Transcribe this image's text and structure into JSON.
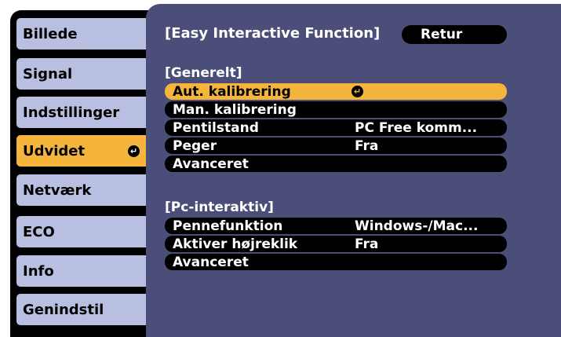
{
  "sidebar": {
    "items": [
      {
        "label": "Billede"
      },
      {
        "label": "Signal"
      },
      {
        "label": "Indstillinger"
      },
      {
        "label": "Udvidet"
      },
      {
        "label": "Netværk"
      },
      {
        "label": "ECO"
      },
      {
        "label": "Info"
      },
      {
        "label": "Genindstil"
      }
    ],
    "active_index": 3
  },
  "header": {
    "title": "[Easy Interactive Function]",
    "return_label": "Retur"
  },
  "sections": [
    {
      "title": "[Generelt]",
      "rows": [
        {
          "label": "Aut. kalibrering",
          "value": "",
          "selected": true
        },
        {
          "label": "Man. kalibrering",
          "value": ""
        },
        {
          "label": "Pentilstand",
          "value": "PC Free komm..."
        },
        {
          "label": "Peger",
          "value": "Fra"
        },
        {
          "label": "Avanceret",
          "value": ""
        }
      ]
    },
    {
      "title": "[Pc-interaktiv]",
      "rows": [
        {
          "label": "Pennefunktion",
          "value": "Windows-/Mac..."
        },
        {
          "label": "Aktiver højreklik",
          "value": "Fra"
        },
        {
          "label": "Avanceret",
          "value": ""
        }
      ]
    }
  ],
  "colors": {
    "accent": "#f5b43b",
    "tab_bg": "#b8bfe0",
    "panel_bg": "#4a4e78"
  },
  "icons": {
    "enter": "enter-icon"
  }
}
